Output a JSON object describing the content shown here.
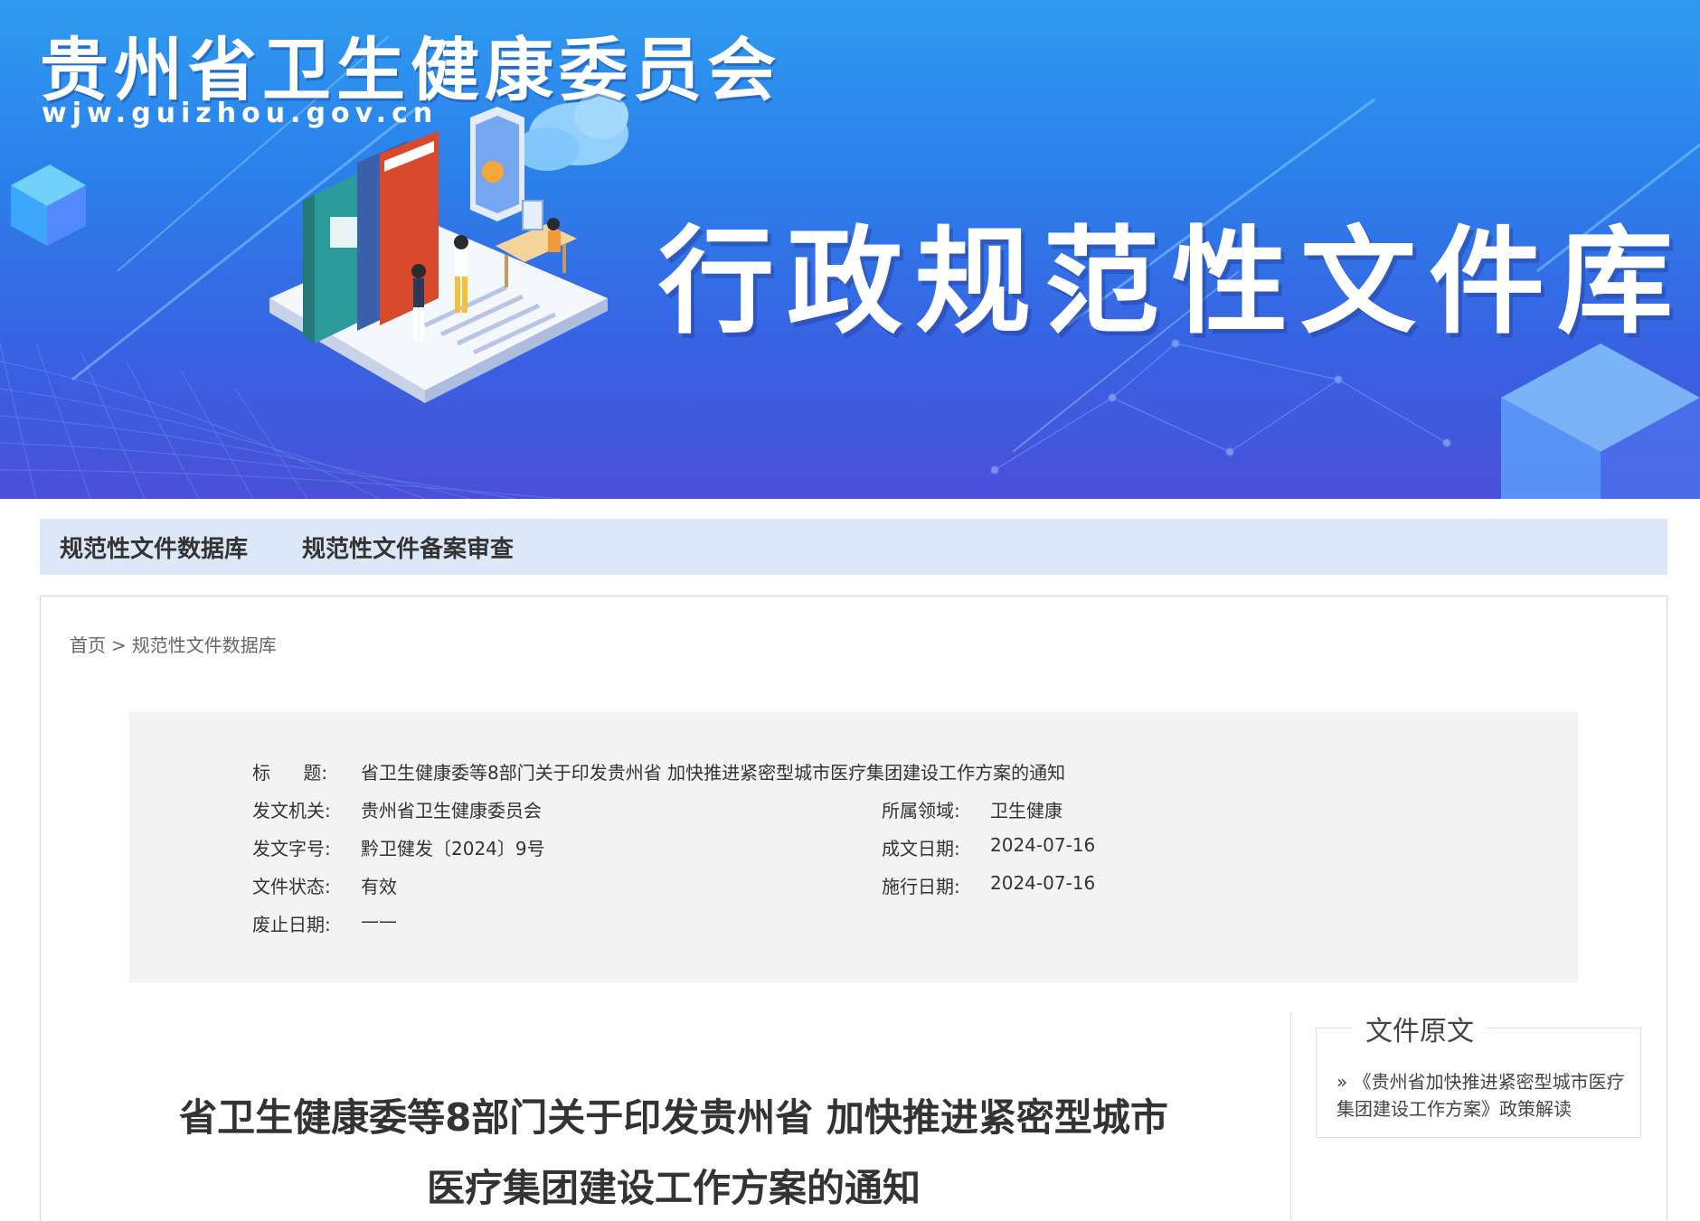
{
  "header": {
    "site_title": "贵州省卫生健康委员会",
    "site_domain": "wjw.guizhou.gov.cn",
    "banner_title": "行政规范性文件库"
  },
  "nav": {
    "items": [
      {
        "label": "规范性文件数据库"
      },
      {
        "label": "规范性文件备案审查"
      }
    ]
  },
  "breadcrumb": {
    "home": "首页",
    "separator": ">",
    "current": "规范性文件数据库"
  },
  "info": {
    "title_label": "标 题:",
    "title_value": "省卫生健康委等8部门关于印发贵州省 加快推进紧密型城市医疗集团建设工作方案的通知",
    "issuer_label": "发文机关:",
    "issuer_value": "贵州省卫生健康委员会",
    "field_label": "所属领域:",
    "field_value": "卫生健康",
    "doc_no_label": "发文字号:",
    "doc_no_value": "黔卫健发〔2024〕9号",
    "created_label": "成文日期:",
    "created_value": "2024-07-16",
    "status_label": "文件状态:",
    "status_value": "有效",
    "effective_label": "施行日期:",
    "effective_value": "2024-07-16",
    "repeal_label": "废止日期:",
    "repeal_value": "——"
  },
  "document": {
    "title_line1": "省卫生健康委等8部门关于印发贵州省 加快推进紧密型城市",
    "title_line2": "医疗集团建设工作方案的通知"
  },
  "sidebar": {
    "title": "文件原文",
    "link": "» 《贵州省加快推进紧密型城市医疗集团建设工作方案》政策解读"
  },
  "colors": {
    "banner_top": "#2f9bf0",
    "banner_bottom": "#4b4fd8",
    "nav_bg": "#dce8f7",
    "info_bg": "#f3f3f3"
  }
}
